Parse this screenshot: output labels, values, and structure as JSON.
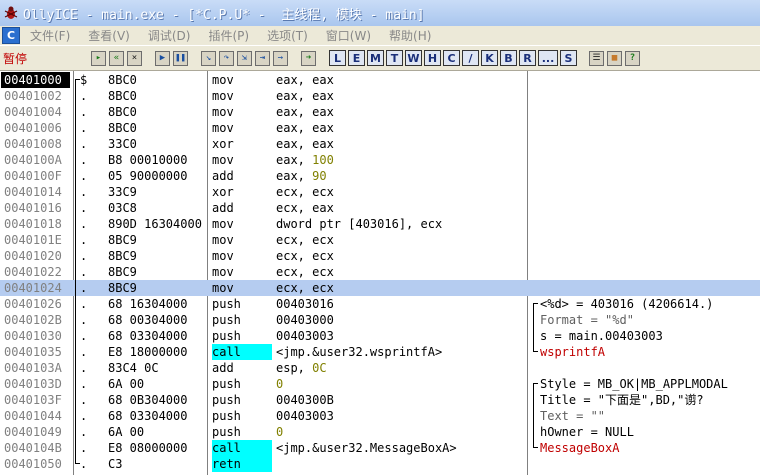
{
  "window": {
    "title": "OllyICE - main.exe - [*C.P.U* -  主线程, 模块 - main]"
  },
  "menu": {
    "icon_label": "C",
    "items": [
      "文件(F)",
      "查看(V)",
      "调试(D)",
      "插件(P)",
      "选项(T)",
      "窗口(W)",
      "帮助(H)"
    ]
  },
  "toolbar": {
    "status": "暂停",
    "buttons": [
      "open-icon",
      "rewind-icon",
      "close-icon",
      "run-icon",
      "pause-icon",
      "step-into-icon",
      "step-over-icon",
      "trace-into-icon",
      "trace-over-icon",
      "execute-till-return-icon",
      "goto-icon"
    ],
    "letters": [
      "L",
      "E",
      "M",
      "T",
      "W",
      "H",
      "C",
      "/",
      "K",
      "B",
      "R",
      "...",
      "S"
    ],
    "extra_icons": [
      "list-icon",
      "grid-icon",
      "help-icon"
    ]
  },
  "disasm": {
    "rows": [
      {
        "addr": "00401000",
        "mark": "$",
        "hex": "8BC0",
        "mnem": "mov",
        "ops": "eax, eax",
        "eip": true
      },
      {
        "addr": "00401002",
        "mark": ".",
        "hex": "8BC0",
        "mnem": "mov",
        "ops": "eax, eax"
      },
      {
        "addr": "00401004",
        "mark": ".",
        "hex": "8BC0",
        "mnem": "mov",
        "ops": "eax, eax"
      },
      {
        "addr": "00401006",
        "mark": ".",
        "hex": "8BC0",
        "mnem": "mov",
        "ops": "eax, eax"
      },
      {
        "addr": "00401008",
        "mark": ".",
        "hex": "33C0",
        "mnem": "xor",
        "ops": "eax, eax"
      },
      {
        "addr": "0040100A",
        "mark": ".",
        "hex": "B8 00010000",
        "mnem": "mov",
        "ops": "eax, ",
        "num": "100"
      },
      {
        "addr": "0040100F",
        "mark": ".",
        "hex": "05 90000000",
        "mnem": "add",
        "ops": "eax, ",
        "num": "90"
      },
      {
        "addr": "00401014",
        "mark": ".",
        "hex": "33C9",
        "mnem": "xor",
        "ops": "ecx, ecx"
      },
      {
        "addr": "00401016",
        "mark": ".",
        "hex": "03C8",
        "mnem": "add",
        "ops": "ecx, eax"
      },
      {
        "addr": "00401018",
        "mark": ".",
        "hex": "890D 16304000",
        "mnem": "mov",
        "ops": "dword ptr [403016], ecx"
      },
      {
        "addr": "0040101E",
        "mark": ".",
        "hex": "8BC9",
        "mnem": "mov",
        "ops": "ecx, ecx"
      },
      {
        "addr": "00401020",
        "mark": ".",
        "hex": "8BC9",
        "mnem": "mov",
        "ops": "ecx, ecx"
      },
      {
        "addr": "00401022",
        "mark": ".",
        "hex": "8BC9",
        "mnem": "mov",
        "ops": "ecx, ecx"
      },
      {
        "addr": "00401024",
        "mark": ".",
        "hex": "8BC9",
        "mnem": "mov",
        "ops": "ecx, ecx",
        "selected": true
      },
      {
        "addr": "00401026",
        "mark": ".",
        "hex": "68 16304000",
        "mnem": "push",
        "ops": "00403016",
        "comment": "<%d> = 403016 (4206614.)"
      },
      {
        "addr": "0040102B",
        "mark": ".",
        "hex": "68 00304000",
        "mnem": "push",
        "ops": "00403000",
        "comment": "Format = \"%d\"",
        "cdim": true
      },
      {
        "addr": "00401030",
        "mark": ".",
        "hex": "68 03304000",
        "mnem": "push",
        "ops": "00403003",
        "comment": "s = main.00403003"
      },
      {
        "addr": "00401035",
        "mark": ".",
        "hex": "E8 18000000",
        "mnem": "call",
        "ops": "<jmp.&user32.wsprintfA>",
        "call": true,
        "comment": "wsprintfA",
        "cfn": true
      },
      {
        "addr": "0040103A",
        "mark": ".",
        "hex": "83C4 0C",
        "mnem": "add",
        "ops": "esp, ",
        "num": "0C"
      },
      {
        "addr": "0040103D",
        "mark": ".",
        "hex": "6A 00",
        "mnem": "push",
        "ops": "",
        "num": "0",
        "comment": "Style = MB_OK|MB_APPLMODAL"
      },
      {
        "addr": "0040103F",
        "mark": ".",
        "hex": "68 0B304000",
        "mnem": "push",
        "ops": "0040300B",
        "comment": "Title = \"下面是\",BD,\"谫?"
      },
      {
        "addr": "00401044",
        "mark": ".",
        "hex": "68 03304000",
        "mnem": "push",
        "ops": "00403003",
        "comment": "Text = \"\"",
        "cdim": true
      },
      {
        "addr": "00401049",
        "mark": ".",
        "hex": "6A 00",
        "mnem": "push",
        "ops": "",
        "num": "0",
        "comment": "hOwner = NULL"
      },
      {
        "addr": "0040104B",
        "mark": ".",
        "hex": "E8 08000000",
        "mnem": "call",
        "ops": "<jmp.&user32.MessageBoxA>",
        "call": true,
        "comment": "MessageBoxA",
        "cfn": true
      },
      {
        "addr": "00401050",
        "mark": ".",
        "hex": "C3",
        "mnem": "retn",
        "ops": "",
        "call": true
      }
    ]
  }
}
